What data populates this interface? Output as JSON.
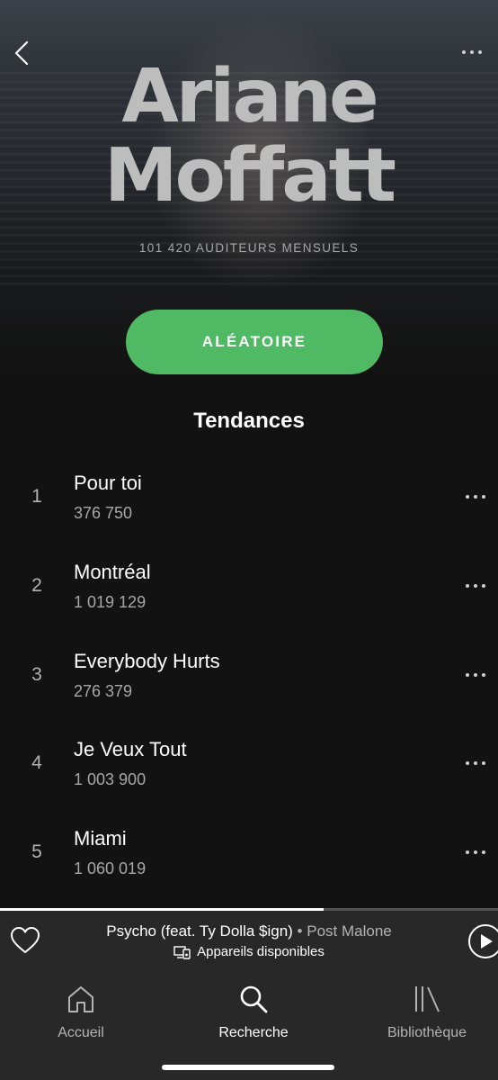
{
  "artist": {
    "name_line1": "Ariane",
    "name_line2": "Moffatt",
    "monthly_listeners": "101 420 AUDITEURS MENSUELS"
  },
  "shuffle_label": "ALÉATOIRE",
  "section_title": "Tendances",
  "tracks": [
    {
      "rank": "1",
      "title": "Pour toi",
      "plays": "376 750"
    },
    {
      "rank": "2",
      "title": "Montréal",
      "plays": "1 019 129"
    },
    {
      "rank": "3",
      "title": "Everybody Hurts",
      "plays": "276 379"
    },
    {
      "rank": "4",
      "title": "Je Veux Tout",
      "plays": "1 003 900"
    },
    {
      "rank": "5",
      "title": "Miami",
      "plays": "1 060 019"
    }
  ],
  "now_playing": {
    "title": "Psycho (feat. Ty Dolla $ign)",
    "separator": " • ",
    "artist": "Post Malone",
    "devices_label": "Appareils disponibles",
    "progress": 0.65
  },
  "tabs": [
    {
      "label": "Accueil",
      "icon": "home-icon",
      "active": false
    },
    {
      "label": "Recherche",
      "icon": "search-icon",
      "active": true
    },
    {
      "label": "Bibliothèque",
      "icon": "library-icon",
      "active": false
    }
  ],
  "colors": {
    "accent_green": "#4fb963",
    "background": "#121212",
    "bar": "#282828"
  }
}
